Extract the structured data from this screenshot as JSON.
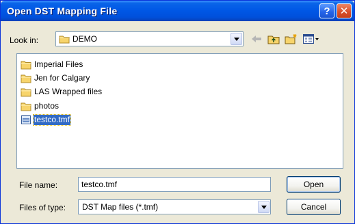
{
  "window": {
    "title": "Open DST Mapping File",
    "help_glyph": "?",
    "close_glyph": "✕"
  },
  "look_in": {
    "label": "Look in:",
    "value": "DEMO",
    "icon": "folder-icon"
  },
  "toolbar": {
    "icons": [
      "back-arrow-icon",
      "up-one-level-icon",
      "new-folder-icon",
      "view-menu-icon"
    ]
  },
  "files": [
    {
      "name": "Imperial Files",
      "type": "folder"
    },
    {
      "name": "Jen for Calgary",
      "type": "folder"
    },
    {
      "name": "LAS Wrapped files",
      "type": "folder"
    },
    {
      "name": "photos",
      "type": "folder"
    },
    {
      "name": "testco.tmf",
      "type": "file",
      "selected": true
    }
  ],
  "file_name": {
    "label": "File name:",
    "value": "testco.tmf"
  },
  "file_type": {
    "label": "Files of type:",
    "value": "DST Map files (*.tmf)"
  },
  "buttons": {
    "open": "Open",
    "cancel": "Cancel"
  },
  "colors": {
    "titlebar": "#0058e6",
    "selection": "#316ac5",
    "dialog_bg": "#ece9d8",
    "folder": "#f7d46b"
  }
}
